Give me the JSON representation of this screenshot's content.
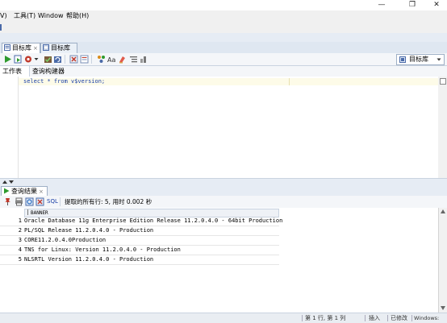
{
  "menu": {
    "item0": "V)",
    "item1": "工具(T)",
    "item2": "Window",
    "item3": "帮助(H)"
  },
  "window_controls": {
    "minimize": "—",
    "restore": "❐",
    "close": "✕"
  },
  "doc_tabs": [
    {
      "label": "目标库",
      "active": true
    },
    {
      "label": "目标库",
      "active": false
    }
  ],
  "tab_close": "×",
  "connection": {
    "label": "目标库"
  },
  "subtabs": [
    "工作表",
    "查询构建器"
  ],
  "editor": {
    "sql": "select * from v$version;"
  },
  "results": {
    "tab_label": "查询结果",
    "tab_close": "×",
    "sql_label": "SQL",
    "status": "提取的所有行: 5, 用时 0.002 秒",
    "column": "BANNER",
    "rows": [
      {
        "n": "1",
        "banner": "Oracle Database 11g Enterprise Edition Release 11.2.0.4.0 - 64bit Production"
      },
      {
        "n": "2",
        "banner": "PL/SQL Release 11.2.0.4.0 - Production"
      },
      {
        "n": "3",
        "banner": "CORE11.2.0.4.0Production"
      },
      {
        "n": "4",
        "banner": "TNS for Linux: Version 11.2.0.4.0 - Production"
      },
      {
        "n": "5",
        "banner": "NLSRTL Version 11.2.0.4.0 - Production"
      }
    ]
  },
  "statusbar": {
    "position": "第 1 行, 第 1 列",
    "mode": "插入",
    "modified": "已修改",
    "eol": "Windows:"
  },
  "colors": {
    "accent": "#1a3fa6",
    "run_green": "#2e9a2e"
  }
}
